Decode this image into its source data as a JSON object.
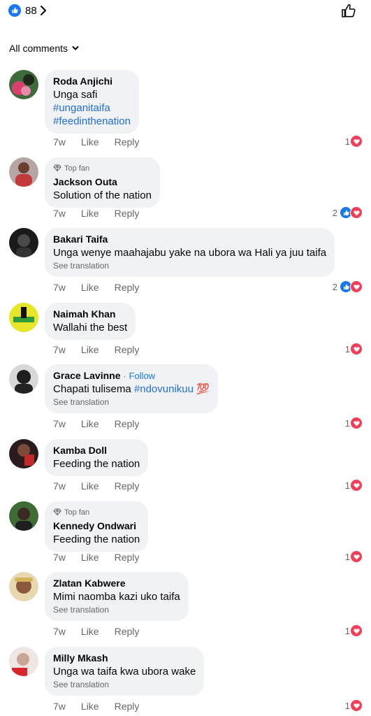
{
  "header": {
    "reaction_count": "88",
    "reaction_icon": "like-icon",
    "chevron_icon": "chevron-right-icon",
    "like_button_icon": "thumbs-up-outline-icon"
  },
  "filter": {
    "label": "All comments",
    "icon": "chevron-down-icon"
  },
  "actions": {
    "like": "Like",
    "reply": "Reply"
  },
  "colors": {
    "link": "#216fdb",
    "bubble": "#f0f2f5",
    "like_blue": "#1877f2",
    "love_red": "#f33e58",
    "meta": "#65676b"
  },
  "comments": [
    {
      "author": "Roda Anjichi",
      "text": "Unga safi",
      "hashtag1": "#unganitaifa",
      "hashtag2": "#feedinthenation",
      "time": "7w",
      "reactions": "1",
      "reaction_types": [
        "love"
      ]
    },
    {
      "badge": "Top fan",
      "author": "Jackson Outa",
      "text": "Solution of the nation",
      "time": "7w",
      "reactions": "2",
      "reaction_types": [
        "like",
        "love"
      ]
    },
    {
      "author": "Bakari Taifa",
      "text": "Unga wenye maahajabu yake na ubora wa Hali ya juu taifa",
      "see_translation": "See translation",
      "time": "7w",
      "reactions": "2",
      "reaction_types": [
        "like",
        "love"
      ]
    },
    {
      "author": "Naimah Khan",
      "text": "Wallahi the best",
      "time": "7w",
      "reactions": "1",
      "reaction_types": [
        "love"
      ]
    },
    {
      "author": "Grace Lavinne",
      "follow": "Follow",
      "text": "Chapati tulisema ",
      "hashtag1": "#ndovunikuu",
      "emoji": "💯",
      "see_translation": "See translation",
      "time": "7w",
      "reactions": "1",
      "reaction_types": [
        "love"
      ]
    },
    {
      "author": "Kamba Doll",
      "text": "Feeding the nation",
      "time": "7w",
      "reactions": "1",
      "reaction_types": [
        "love"
      ]
    },
    {
      "badge": "Top fan",
      "author": "Kennedy Ondwari",
      "text": "Feeding the nation",
      "time": "7w",
      "reactions": "1",
      "reaction_types": [
        "love"
      ]
    },
    {
      "author": "Zlatan Kabwere",
      "text": "Mimi naomba kazi uko taifa",
      "see_translation": "See translation",
      "time": "7w",
      "reactions": "1",
      "reaction_types": [
        "love"
      ]
    },
    {
      "author": "Milly Mkash",
      "text": "Unga wa taifa kwa ubora wake",
      "see_translation": "See translation",
      "time": "7w",
      "reactions": "1",
      "reaction_types": [
        "love"
      ]
    }
  ]
}
